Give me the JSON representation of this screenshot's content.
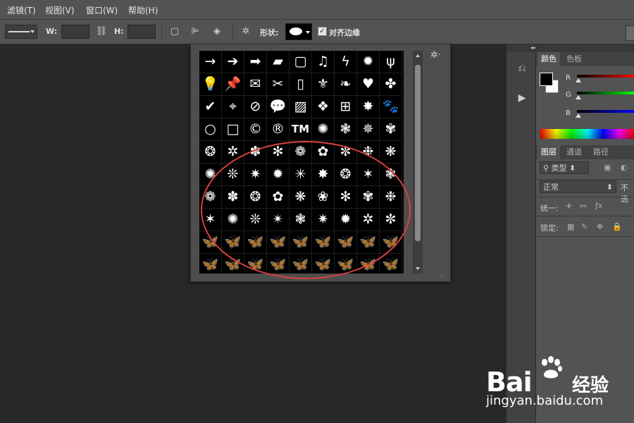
{
  "menubar": {
    "items": [
      "滤镜(T)",
      "视图(V)",
      "窗口(W)",
      "帮助(H)"
    ]
  },
  "options": {
    "w_label": "W:",
    "h_label": "H:",
    "shape_label": "形状:",
    "align_label": "对齐边缘",
    "align_checked": true
  },
  "shape_picker": {
    "rows": [
      [
        "→",
        "➔",
        "➡",
        "▰",
        "▢",
        "♫",
        "ϟ",
        "✹",
        "ψ"
      ],
      [
        "💡",
        "📌",
        "✉",
        "✂",
        "▯",
        "⚜",
        "❧",
        "♥",
        "✤"
      ],
      [
        "✔",
        "⌖",
        "⊘",
        "💬",
        "▨",
        "❖",
        "⊞",
        "✸",
        "🐾"
      ],
      [
        "○",
        "□",
        "©",
        "®",
        "TM",
        "✺",
        "❃",
        "✵",
        "✾"
      ],
      [
        "❂",
        "✲",
        "✽",
        "✻",
        "❁",
        "✿",
        "✼",
        "❉",
        "❋"
      ],
      [
        "✺",
        "❊",
        "✷",
        "✹",
        "✳",
        "✸",
        "❂",
        "✶",
        "❃"
      ],
      [
        "❁",
        "✽",
        "❂",
        "✿",
        "❋",
        "❀",
        "✻",
        "✾",
        "❉"
      ],
      [
        "✶",
        "✺",
        "❊",
        "✴",
        "❃",
        "✷",
        "✹",
        "✲",
        "✼"
      ],
      [
        "🦋",
        "🦋",
        "🦋",
        "🦋",
        "🦋",
        "🦋",
        "🦋",
        "🦋",
        "🦋"
      ],
      [
        "🦋",
        "🦋",
        "🦋",
        "🦋",
        "🦋",
        "🦋",
        "🦋",
        "🦋",
        "🦋"
      ]
    ]
  },
  "right_panel": {
    "color_tabs": [
      "颜色",
      "色板"
    ],
    "channels": [
      {
        "label": "R",
        "color": "#ff0000"
      },
      {
        "label": "G",
        "color": "#00ff00"
      },
      {
        "label": "B",
        "color": "#0000ff"
      }
    ],
    "layer_tabs": [
      "图层",
      "通道",
      "路径"
    ],
    "kind_filter": "类型",
    "blend_mode": "正常",
    "opacity_label": "不透",
    "unify_label": "统一:",
    "lock_label": "锁定:"
  },
  "watermark": {
    "bai": "Bai",
    "du": "du",
    "jingyan": "经验",
    "url": "jingyan.baidu.com"
  },
  "colors": {
    "annotation": "#d94040",
    "panel_bg": "#535353",
    "canvas_bg": "#282828"
  }
}
